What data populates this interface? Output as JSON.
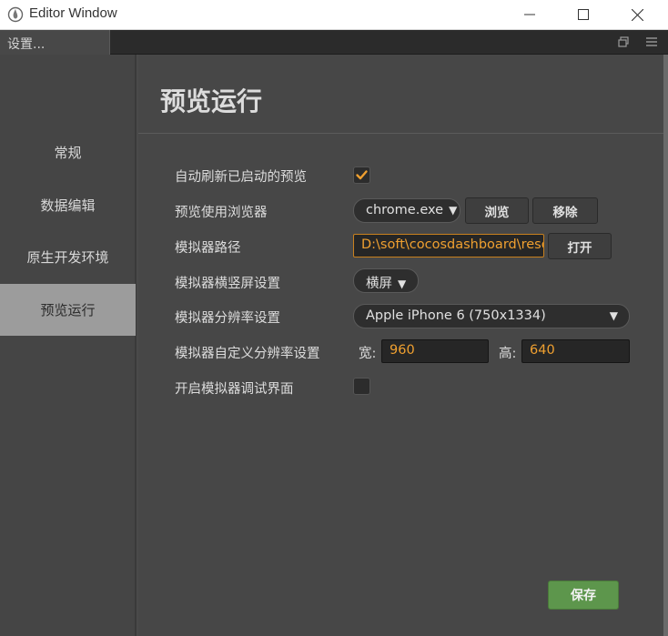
{
  "window": {
    "title": "Editor Window"
  },
  "tab": {
    "label": "设置..."
  },
  "sidebar": {
    "items": [
      {
        "label": "常规"
      },
      {
        "label": "数据编辑"
      },
      {
        "label": "原生开发环境"
      },
      {
        "label": "预览运行",
        "active": true
      }
    ]
  },
  "main": {
    "title": "预览运行",
    "rows": {
      "auto_refresh": {
        "label": "自动刷新已启动的预览",
        "checked": true
      },
      "browser": {
        "label": "预览使用浏览器",
        "value": "chrome.exe",
        "browse": "浏览",
        "remove": "移除"
      },
      "sim_path": {
        "label": "模拟器路径",
        "value": "D:\\soft\\cocosdashboard\\reso",
        "open": "打开"
      },
      "orientation": {
        "label": "模拟器横竖屏设置",
        "value": "横屏"
      },
      "resolution": {
        "label": "模拟器分辨率设置",
        "value": "Apple iPhone 6 (750x1334)"
      },
      "custom_res": {
        "label": "模拟器自定义分辨率设置",
        "width_label": "宽:",
        "width": "960",
        "height_label": "高:",
        "height": "640"
      },
      "debug": {
        "label": "开启模拟器调试界面",
        "checked": false
      }
    },
    "save": "保存"
  },
  "colors": {
    "accent": "#f0a030",
    "save": "#5d964c",
    "active_nav": "#9c9c9c"
  },
  "icons": [
    "app-drop-icon",
    "minimize-icon",
    "maximize-icon",
    "close-icon",
    "restore-panel-icon",
    "menu-icon",
    "checkmark-icon",
    "caret-down-icon"
  ]
}
